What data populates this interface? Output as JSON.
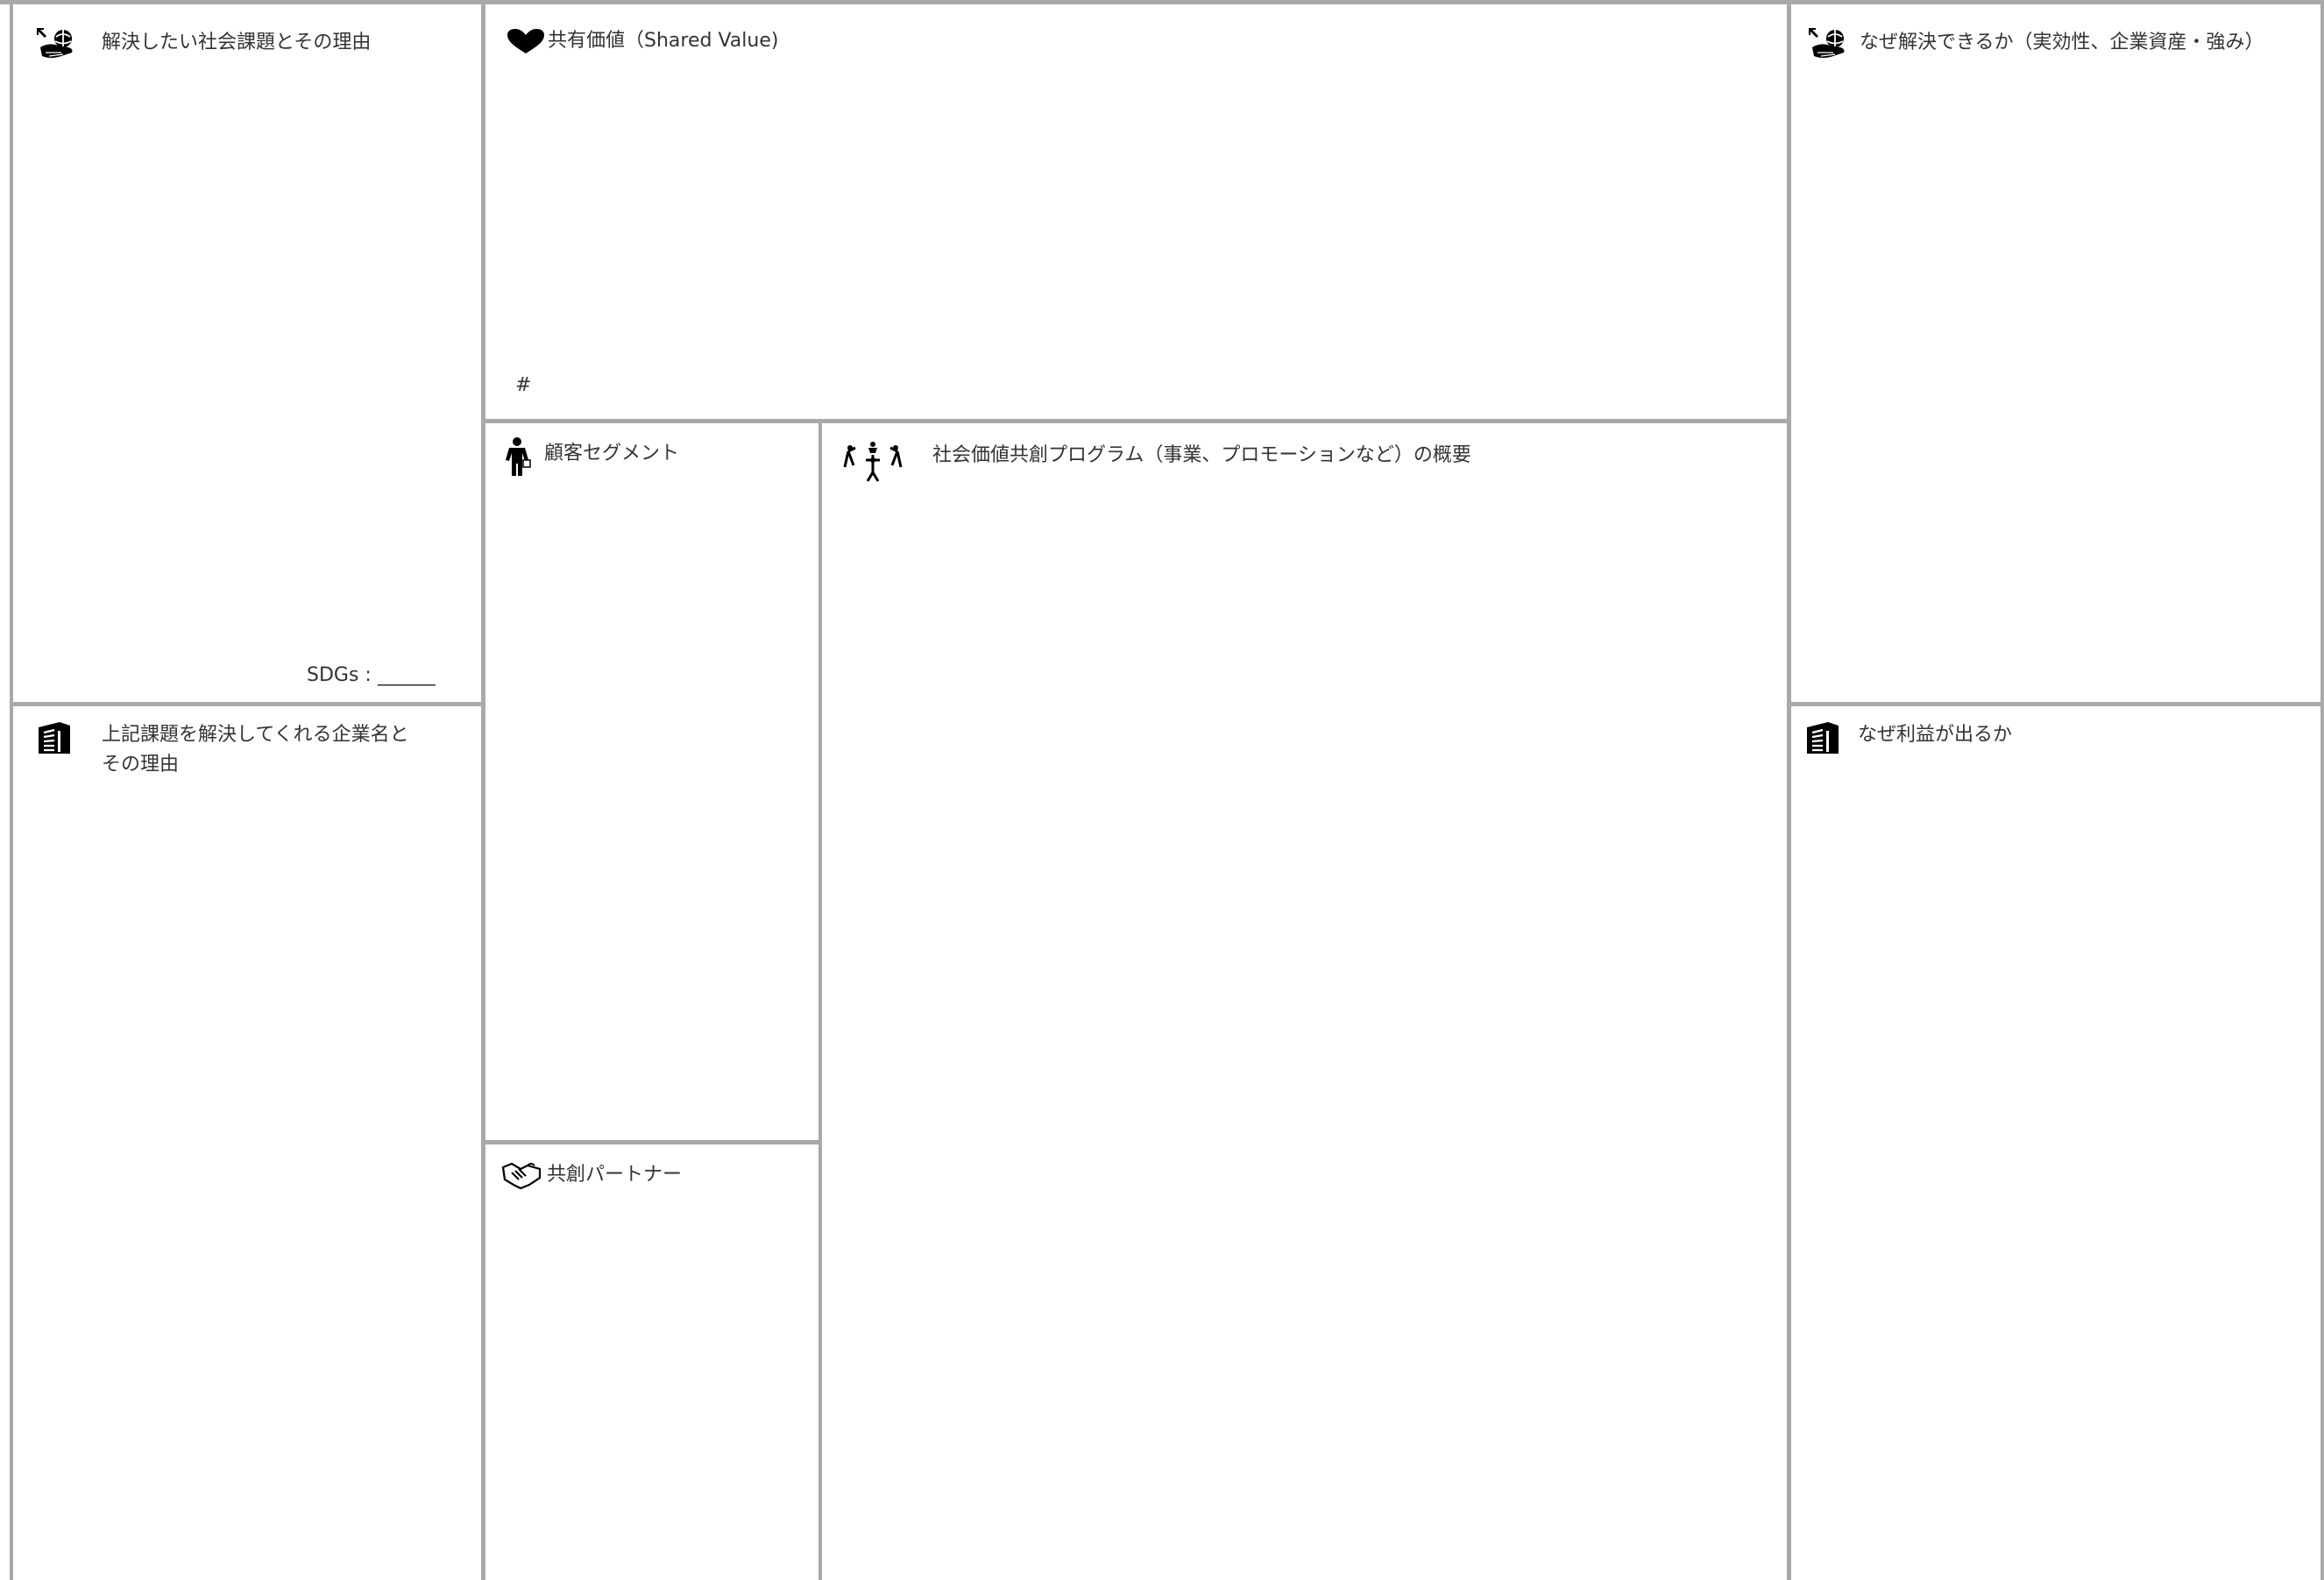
{
  "canvas": {
    "background": "#ffffff",
    "line_color": "#a9a9a9",
    "text_color": "#333333"
  },
  "panels": {
    "social_issue": {
      "title": "解決したい社会課題とその理由",
      "icon": "hand-with-globe-icon",
      "sdgs_label": "SDGs : ______"
    },
    "company": {
      "title": "上記課題を解決してくれる企業名と\nその理由",
      "icon": "building-icon"
    },
    "shared_value": {
      "title": "共有価値（Shared Value)",
      "icon": "heart-icon",
      "hash": "#"
    },
    "customer_segment": {
      "title": "顧客セグメント",
      "icon": "person-icon"
    },
    "co_creation_partner": {
      "title": "共創パートナー",
      "icon": "handshake-icon"
    },
    "program_overview": {
      "title": "社会価値共創プログラム（事業、プロモーションなど）の概要",
      "icon": "people-celebrating-icon"
    },
    "why_solvable": {
      "title": "なぜ解決できるか（実効性、企業資産・強み）",
      "icon": "hand-with-globe-icon"
    },
    "why_profitable": {
      "title": "なぜ利益が出るか",
      "icon": "building-icon"
    }
  }
}
